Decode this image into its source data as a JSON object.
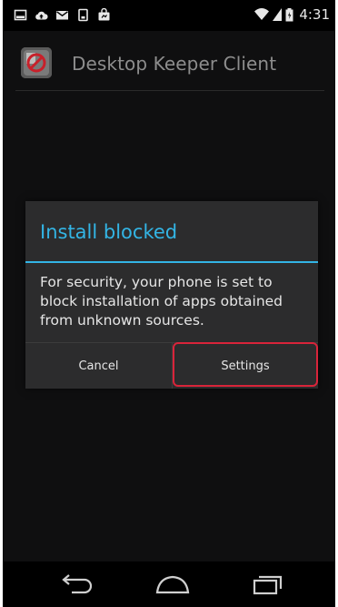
{
  "status_bar": {
    "time": "4:31",
    "icons": [
      "image-icon",
      "cloud-upload-icon",
      "mail-icon",
      "sim-card-icon",
      "bag-icon",
      "wifi-icon",
      "signal-icon",
      "battery-icon"
    ]
  },
  "action_bar": {
    "app_title": "Desktop Keeper Client",
    "app_icon": "app-icon"
  },
  "dialog": {
    "title": "Install blocked",
    "message": "For security, your phone is set to block installation of apps obtained from unknown sources.",
    "cancel_label": "Cancel",
    "settings_label": "Settings",
    "accent_color": "#33b5e5",
    "highlight_color": "#d9243a"
  },
  "nav_bar": {
    "icons": [
      "back-icon",
      "home-icon",
      "recent-apps-icon"
    ]
  }
}
